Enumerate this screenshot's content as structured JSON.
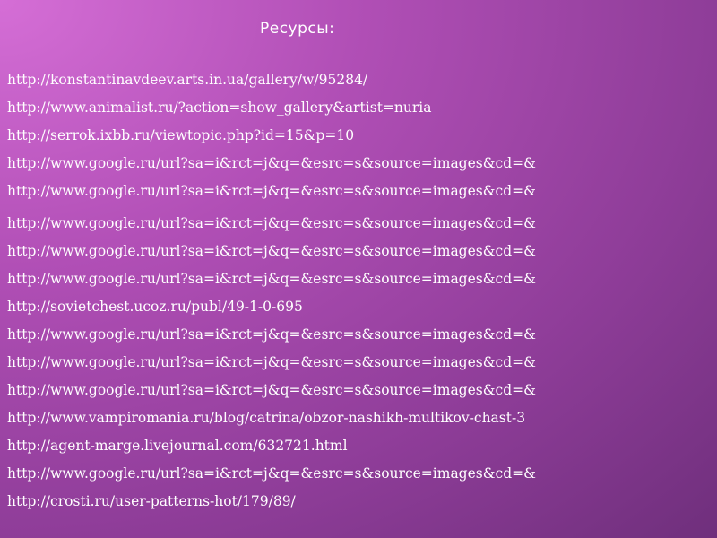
{
  "slide": {
    "title": "Ресурсы:",
    "links": [
      "http://konstantinavdeev.arts.in.ua/gallery/w/95284/",
      "http://www.animalist.ru/?action=show_gallery&artist=nuria",
      "http://serrok.ixbb.ru/viewtopic.php?id=15&p=10",
      "http://www.google.ru/url?sa=i&rct=j&q=&esrc=s&source=images&cd=&",
      "http://www.google.ru/url?sa=i&rct=j&q=&esrc=s&source=images&cd=&",
      "http://www.google.ru/url?sa=i&rct=j&q=&esrc=s&source=images&cd=&",
      "http://www.google.ru/url?sa=i&rct=j&q=&esrc=s&source=images&cd=&",
      "http://www.google.ru/url?sa=i&rct=j&q=&esrc=s&source=images&cd=&",
      "http://sovietchest.ucoz.ru/publ/49-1-0-695",
      "http://www.google.ru/url?sa=i&rct=j&q=&esrc=s&source=images&cd=&",
      "http://www.google.ru/url?sa=i&rct=j&q=&esrc=s&source=images&cd=&",
      "http://www.google.ru/url?sa=i&rct=j&q=&esrc=s&source=images&cd=&",
      "http://www.vampiromania.ru/blog/catrina/obzor-nashikh-multikov-chast-3",
      "http://agent-marge.livejournal.com/632721.html",
      "http://www.google.ru/url?sa=i&rct=j&q=&esrc=s&source=images&cd=&",
      "http://crosti.ru/user-patterns-hot/179/89/"
    ]
  }
}
